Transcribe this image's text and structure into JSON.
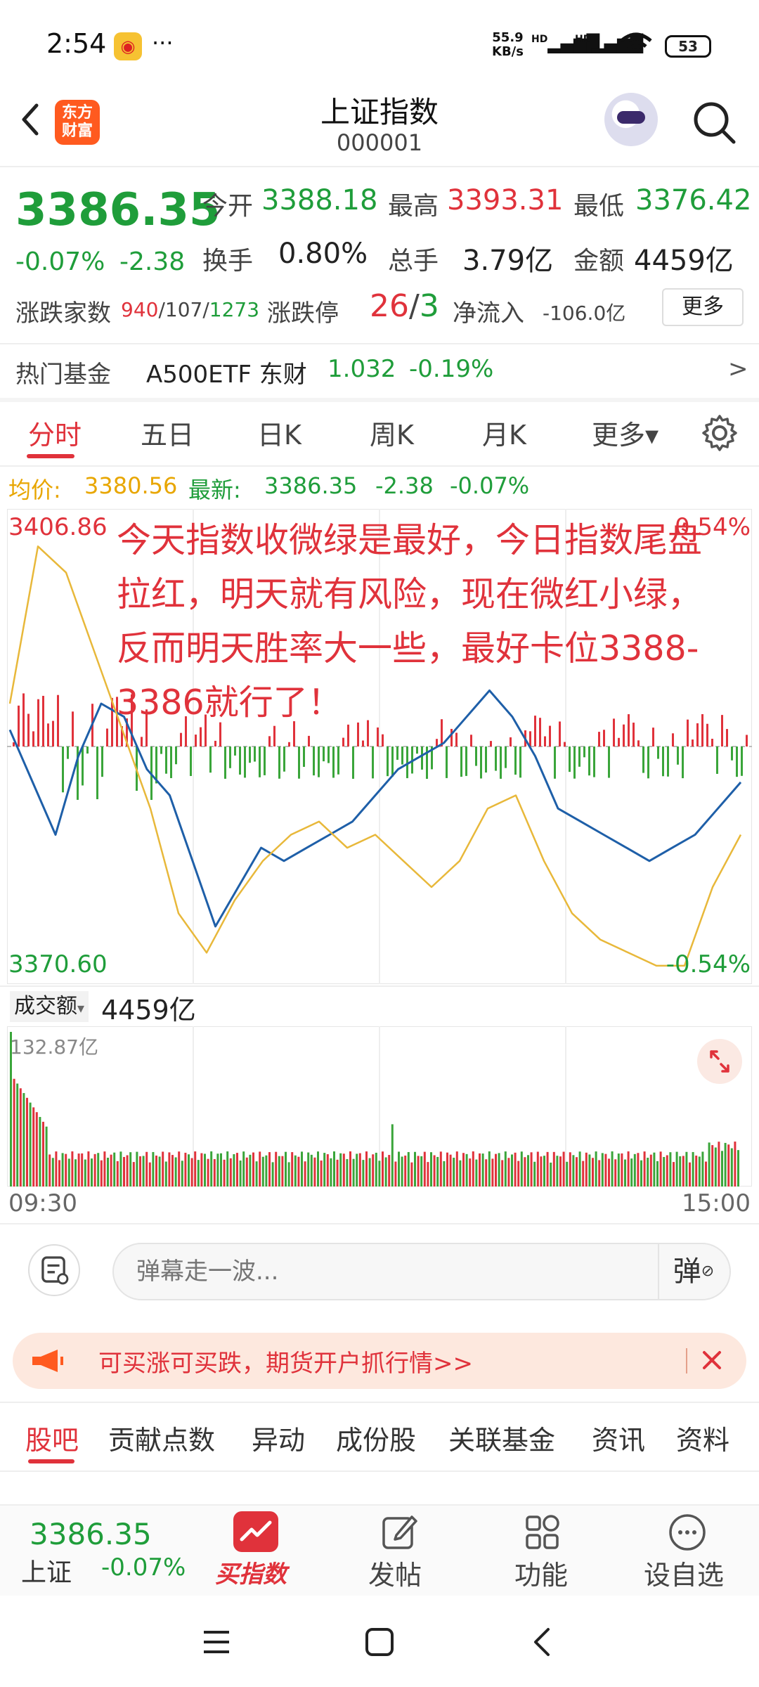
{
  "status_bar": {
    "time": "2:54",
    "more": "···",
    "net_speed": "55.9",
    "net_unit": "KB/s",
    "sig1": "HD",
    "sig2": "HD",
    "battery": "53"
  },
  "header": {
    "logo_line1": "东方",
    "logo_line2": "财富",
    "title": "上证指数",
    "code": "000001"
  },
  "quote": {
    "price": "3386.35",
    "change_pct": "-0.07%",
    "change": "-2.38",
    "open_label": "今开",
    "open": "3388.18",
    "high_label": "最高",
    "high": "3393.31",
    "low_label": "最低",
    "low": "3376.42",
    "turnover_label": "换手",
    "turnover": "0.80%",
    "volume_label": "总手",
    "volume": "3.79亿",
    "amount_label": "金额",
    "amount": "4459亿",
    "breadth_label": "涨跌家数",
    "breadth_up": "940",
    "sep1": "/",
    "breadth_flat": "107",
    "sep2": "/",
    "breadth_down": "1273",
    "limit_label": "涨跌停",
    "limit_up": "26",
    "sep3": "/",
    "limit_down": "3",
    "netflow_label": "净流入",
    "netflow": "-106.0亿",
    "more_button": "更多"
  },
  "fund": {
    "label": "热门基金",
    "name": "A500ETF 东财",
    "price": "1.032",
    "change": "-0.19%",
    "arrow": ">"
  },
  "period_tabs": [
    "分时",
    "五日",
    "日K",
    "周K",
    "月K",
    "更多▾"
  ],
  "avg_row": {
    "avg_label": "均价:",
    "avg": "3380.56",
    "latest_label": "最新:",
    "latest": "3386.35",
    "change": "-2.38",
    "change_pct": "-0.07%"
  },
  "chart_data": {
    "type": "line",
    "y_top": "3406.86",
    "y_bottom": "3370.60",
    "pct_top": "0.54%",
    "pct_bottom": "-0.54%",
    "ylim": [
      3370.6,
      3406.86
    ],
    "prev_close": 3388.73,
    "series": [
      {
        "values": [
          3390,
          3386,
          3382,
          3388,
          3392,
          3391,
          3387,
          3385,
          3380,
          3375,
          3378,
          3381,
          3380,
          3381,
          3382,
          3383,
          3385,
          3387,
          3388,
          3389,
          3391,
          3393,
          3391,
          3388,
          3384,
          3383,
          3382,
          3381,
          3380,
          3381,
          3382,
          3384,
          3386
        ],
        "color": "#1e5fa8"
      },
      {
        "values": [
          3392,
          3404,
          3402,
          3396,
          3390,
          3384,
          3376,
          3373,
          3377,
          3380,
          3382,
          3383,
          3381,
          3382,
          3380,
          3378,
          3380,
          3384,
          3385,
          3380,
          3376,
          3374,
          3373,
          3372,
          3372,
          3378,
          3382
        ],
        "color": "#e8b83a"
      }
    ],
    "xticks": [
      "09:30",
      "15:00"
    ]
  },
  "annotation": "今天指数收微绿是最好，今日指数尾盘拉红，明天就有风险，现在微红小绿，反而明天胜率大一些，最好卡位3388-3386就行了！",
  "volume": {
    "label": "成交额",
    "dropdown": "▾",
    "total": "4459亿",
    "max": "132.87亿",
    "time_start": "09:30",
    "time_end": "15:00"
  },
  "danmu": {
    "placeholder": "弹幕走一波...",
    "button": "弹"
  },
  "promo": {
    "text": "可买涨可买跌，期货开户抓行情>>"
  },
  "content_tabs": [
    "股吧",
    "贡献点数",
    "异动",
    "成份股",
    "关联基金",
    "资讯",
    "资料"
  ],
  "bottom_bar": {
    "price": "3386.35",
    "name": "上证",
    "change": "-0.07%",
    "buy": "买指数",
    "post": "发帖",
    "functions": "功能",
    "watchlist": "设自选"
  },
  "colors": {
    "red": "#e0323b",
    "green": "#1f9d3a",
    "price_line": "#1e5fa8",
    "avg_line": "#e8b83a"
  }
}
